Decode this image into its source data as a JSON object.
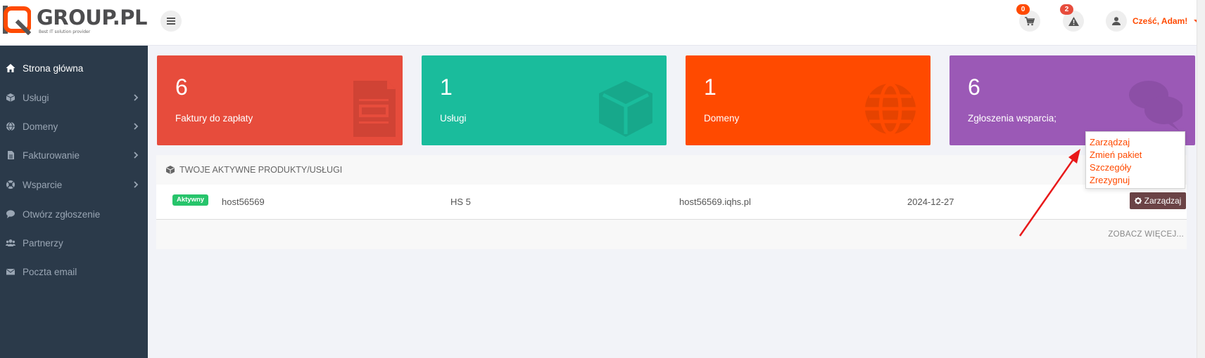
{
  "header": {
    "logo_text": "GROUP.PL",
    "logo_tagline": "Best IT solution provider",
    "cart_count": "0",
    "alerts_count": "2",
    "user_greeting": "Cześć, Adam!"
  },
  "sidebar": {
    "items": [
      {
        "label": "Strona główna",
        "icon": "home-icon",
        "active": true
      },
      {
        "label": "Usługi",
        "icon": "cube-icon",
        "has_submenu": true
      },
      {
        "label": "Domeny",
        "icon": "globe-icon",
        "has_submenu": true
      },
      {
        "label": "Fakturowanie",
        "icon": "file-icon",
        "has_submenu": true
      },
      {
        "label": "Wsparcie",
        "icon": "lifebuoy-icon",
        "has_submenu": true
      },
      {
        "label": "Otwórz zgłoszenie",
        "icon": "comment-icon"
      },
      {
        "label": "Partnerzy",
        "icon": "users-icon"
      },
      {
        "label": "Poczta email",
        "icon": "envelope-icon"
      }
    ]
  },
  "stats": [
    {
      "value": "6",
      "label": "Faktury do zapłaty",
      "color": "#e74c3c",
      "icon": "invoice-icon"
    },
    {
      "value": "1",
      "label": "Usługi",
      "color": "#1abc9c",
      "icon": "cube-icon"
    },
    {
      "value": "1",
      "label": "Domeny",
      "color": "#ff4a00",
      "icon": "globe-icon"
    },
    {
      "value": "6",
      "label": "Zgłoszenia wsparcia;",
      "color": "#9b59b6",
      "icon": "comments-icon"
    }
  ],
  "products": {
    "title": "TWOJE AKTYWNE PRODUKTY/USŁUGI",
    "rows": [
      {
        "status": "Aktywny",
        "name": "host56569",
        "plan": "HS 5",
        "domain": "host56569.iqhs.pl",
        "date": "2024-12-27",
        "action": "Zarządzaj"
      }
    ],
    "see_more": "ZOBACZ WIĘCEJ..."
  },
  "dropdown": {
    "items": [
      "Zarządzaj",
      "Zmień pakiet",
      "Szczegóły",
      "Zrezygnuj"
    ]
  },
  "colors": {
    "accent": "#ff4a00",
    "sidebar_bg": "#2b3a4a",
    "active_green": "#27c46b",
    "annotation_arrow": "#e8191a"
  }
}
